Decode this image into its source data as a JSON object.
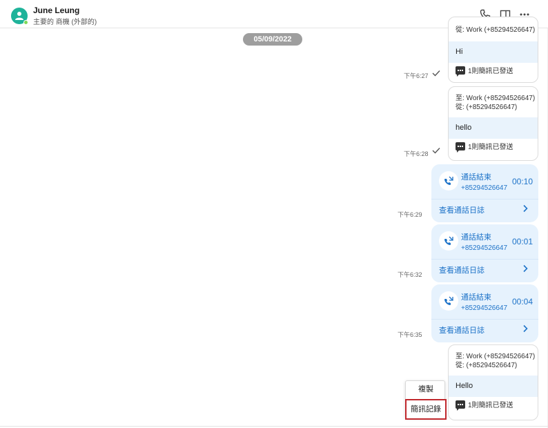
{
  "header": {
    "contact_name": "June Leung",
    "contact_subtitle": "主要的 商機 (外部的)",
    "avatar_color": "#1fb39a",
    "icons": [
      "phone-icon",
      "side-panel-icon",
      "more-icon"
    ]
  },
  "date_separator": "05/09/2022",
  "sms_messages": [
    {
      "to": "",
      "from": "從: Work (+85294526647)",
      "body": "Hi",
      "status": "1則簡訊已發送",
      "time": "下午6:27"
    },
    {
      "to": "至: Work (+85294526647)",
      "from": "從: (+85294526647)",
      "body": "hello",
      "status": "1則簡訊已發送",
      "time": "下午6:28"
    },
    {
      "to": "至: Work (+85294526647)",
      "from": "從: (+85294526647)",
      "body": "Hello",
      "status": "1則簡訊已發送"
    }
  ],
  "calls": [
    {
      "title": "通話結束",
      "number": "+85294526647",
      "duration": "00:10",
      "link": "查看通話日誌",
      "time": "下午6:29"
    },
    {
      "title": "通話結束",
      "number": "+85294526647",
      "duration": "00:01",
      "link": "查看通話日誌",
      "time": "下午6:32"
    },
    {
      "title": "通話結束",
      "number": "+85294526647",
      "duration": "00:04",
      "link": "查看通話日誌",
      "time": "下午6:35"
    }
  ],
  "context_menu": {
    "copy": "複製",
    "sms_log": "簡訊記錄"
  },
  "colors": {
    "accent_blue": "#1e73c8",
    "call_bubble": "#e6f2fd",
    "highlight_red": "#c0282d"
  }
}
